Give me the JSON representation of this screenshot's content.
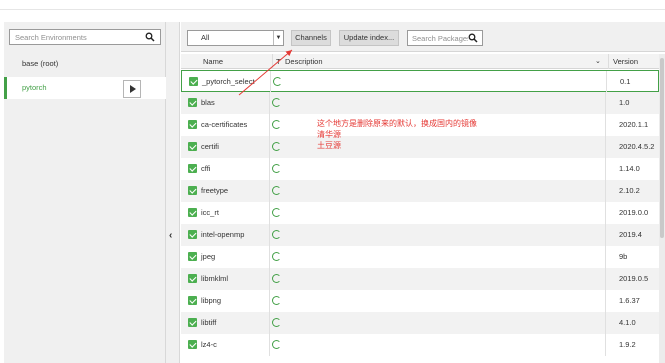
{
  "environments": {
    "search_placeholder": "Search Environments",
    "items": [
      {
        "label": "base (root)"
      },
      {
        "label": "pytorch"
      }
    ]
  },
  "toolbar": {
    "filter_value": "All",
    "channels_label": "Channels",
    "update_label": "Update index...",
    "search_placeholder": "Search Packages"
  },
  "table": {
    "headers": {
      "name": "Name",
      "t": "T",
      "description": "Description",
      "version": "Version"
    },
    "rows": [
      {
        "name": "_pytorch_select",
        "version": "0.1"
      },
      {
        "name": "blas",
        "version": "1.0"
      },
      {
        "name": "ca-certificates",
        "version": "2020.1.1"
      },
      {
        "name": "certifi",
        "version": "2020.4.5.2"
      },
      {
        "name": "cffi",
        "version": "1.14.0"
      },
      {
        "name": "freetype",
        "version": "2.10.2"
      },
      {
        "name": "icc_rt",
        "version": "2019.0.0"
      },
      {
        "name": "intel-openmp",
        "version": "2019.4"
      },
      {
        "name": "jpeg",
        "version": "9b"
      },
      {
        "name": "libmklml",
        "version": "2019.0.5"
      },
      {
        "name": "libpng",
        "version": "1.6.37"
      },
      {
        "name": "libtiff",
        "version": "4.1.0"
      },
      {
        "name": "lz4-c",
        "version": "1.9.2"
      }
    ]
  },
  "annotation": {
    "line1": "这个地方是删除原来的默认，换成国内的镜像",
    "line2": "清华源",
    "line3": "土豆源"
  },
  "colors": {
    "accent": "#43a047",
    "annotation": "#e53935"
  }
}
